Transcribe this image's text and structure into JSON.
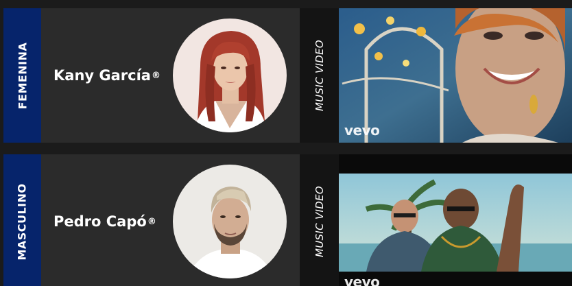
{
  "rows": [
    {
      "category": "FEMENINA",
      "artist": "Kany García",
      "artist_mark": "®",
      "media_label": "MUSIC VIDEO",
      "video_brand": "vevo"
    },
    {
      "category": "MASCULINO",
      "artist": "Pedro Capó",
      "artist_mark": "®",
      "media_label": "MUSIC VIDEO",
      "video_brand": "vevo"
    }
  ],
  "colors": {
    "category_strip": "#06246b",
    "card_background": "#2b2b2b",
    "page_background": "#1b1b1b"
  }
}
